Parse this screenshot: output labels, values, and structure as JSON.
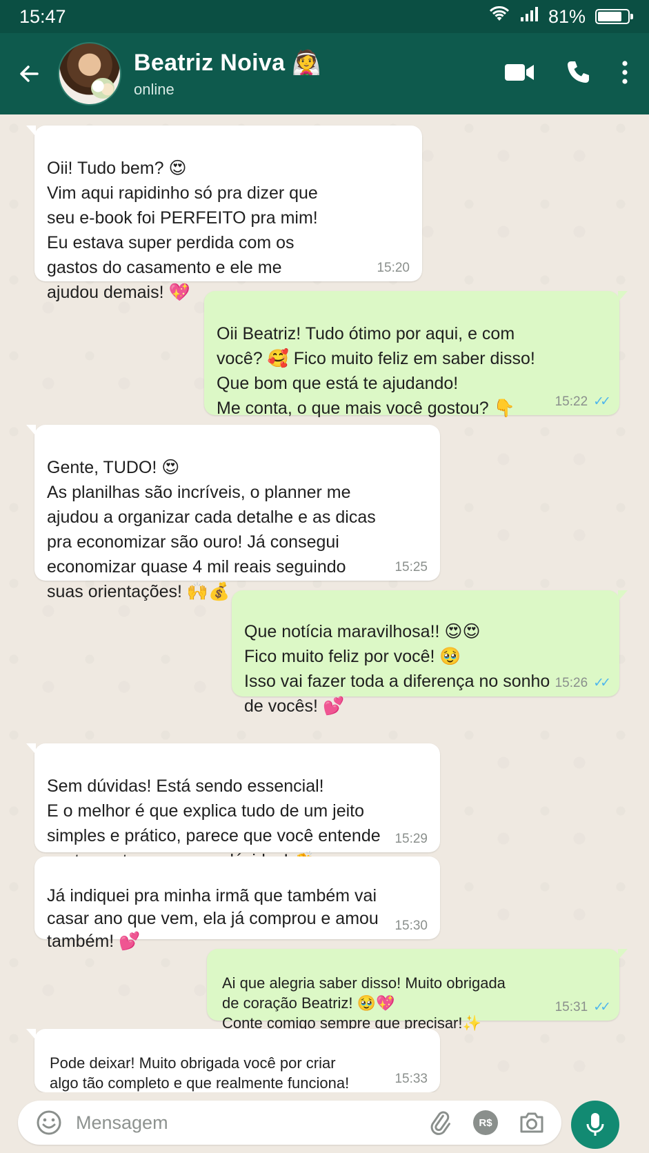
{
  "status_bar": {
    "time": "15:47",
    "battery": "81%",
    "battery_level": 0.81
  },
  "header": {
    "name": "Beatriz Noiva 👰",
    "status": "online"
  },
  "messages": [
    {
      "text": "Oii! Tudo bem? 😍\nVim aqui rapidinho só pra dizer que\nseu e-book foi PERFEITO pra mim!\nEu estava super perdida com os\ngastos do casamento e ele me\najudou demais! 💖",
      "time": "15:20"
    },
    {
      "text": "Oii Beatriz! Tudo ótimo por aqui, e com\nvocê? 🥰 Fico muito feliz em saber disso!\nQue bom que está te ajudando!\nMe conta, o que mais você gostou? 👇",
      "time": "15:22",
      "ticks": "✓✓"
    },
    {
      "text": "Gente, TUDO! 😍\nAs planilhas são incríveis, o planner me\najudou a organizar cada detalhe e as dicas\npra economizar são ouro! Já consegui\neconomizar quase 4 mil reais seguindo\nsuas orientações! 🙌💰",
      "time": "15:25"
    },
    {
      "text": "Que notícia maravilhosa!! 😍😍\nFico muito feliz por você! 🥹\nIsso vai fazer toda a diferença no sonho\nde vocês! 💕",
      "time": "15:26",
      "ticks": "✓✓"
    },
    {
      "text": "Sem dúvidas! Está sendo essencial!\nE o melhor é que explica tudo de um jeito\nsimples e prático, parece que você entende\nexatamente as nossas dúvidas! 👏",
      "time": "15:29"
    },
    {
      "text": "Já indiquei pra minha irmã que também vai\ncasar ano que vem, ela já comprou e amou\ntambém! 💕",
      "time": "15:30"
    },
    {
      "text": "Ai que alegria saber disso! Muito obrigada\nde coração Beatriz! 🥹💖\nConte comigo sempre que precisar!✨",
      "time": "15:31",
      "ticks": "✓✓"
    },
    {
      "text": "Pode deixar! Muito obrigada você por criar\nalgo tão completo e que realmente funciona!\nDeus abençoe muito! 🙏💖",
      "time": "15:33"
    }
  ],
  "composer": {
    "placeholder": "Mensagem",
    "currency_badge": "R$"
  },
  "colors": {
    "header": "#0e5a4d",
    "outgoing": "#dcf8c6",
    "incoming": "#ffffff",
    "tick_read": "#4fb6ec",
    "send": "#128a72"
  }
}
